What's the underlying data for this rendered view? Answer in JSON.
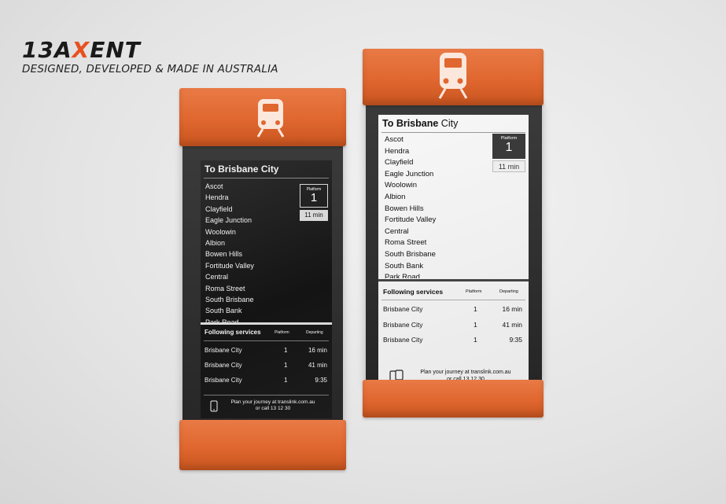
{
  "brand": {
    "logo_pre": "13A",
    "logo_x": "X",
    "logo_post": "ENT",
    "tagline": "DESIGNED, DEVELOPED & MADE IN AUSTRALIA"
  },
  "sign": {
    "title_main": "To Brisbane",
    "title_light": "City",
    "stations": [
      "Ascot",
      "Hendra",
      "Clayfield",
      "Eagle Junction",
      "Woolowin",
      "Albion",
      "Bowen Hills",
      "Fortitude Valley",
      "Central",
      "Roma Street",
      "South Brisbane",
      "South Bank",
      "Park Road"
    ],
    "platform_label": "Platform",
    "platform_number": "1",
    "minutes": "11 min",
    "following_title": "Following services",
    "col_platform": "Platform",
    "col_departing": "Departing",
    "services": [
      {
        "destination": "Brisbane City",
        "platform": "1",
        "departing": "16 min"
      },
      {
        "destination": "Brisbane City",
        "platform": "1",
        "departing": "41 min"
      },
      {
        "destination": "Brisbane City",
        "platform": "1",
        "departing": "9:35"
      }
    ],
    "journey_line1": "Plan your journey at translink.com.au",
    "journey_line2": "or call 13 12 30"
  },
  "icons": {
    "train": "train-icon",
    "phone": "phone-icon"
  },
  "colors": {
    "accent": "#e0672f",
    "housing": "#2a2a2a",
    "logo_x": "#e8511e"
  }
}
